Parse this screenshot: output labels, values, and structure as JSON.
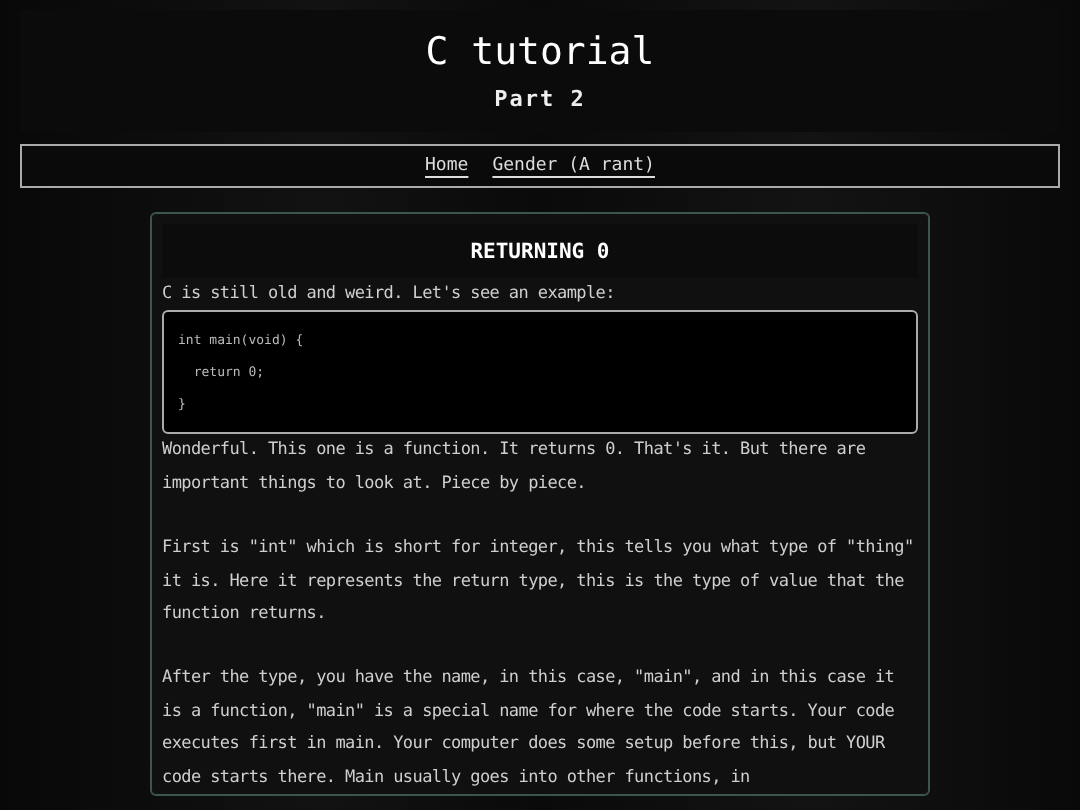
{
  "header": {
    "title": "C tutorial",
    "subtitle": "Part 2"
  },
  "nav": [
    {
      "label": "Home"
    },
    {
      "label": "Gender (A rant)"
    }
  ],
  "article": {
    "heading": "RETURNING 0",
    "intro": "C is still old and weird. Let's see an example:",
    "code_lines": [
      "int main(void) {",
      "  return 0;",
      "}"
    ],
    "paragraphs": [
      "Wonderful. This one is a function. It returns 0. That's it. But there are important things to look at. Piece by piece.",
      "First is \"int\" which is short for integer, this tells you what type of \"thing\" it is. Here it represents the return type, this is the type of value that the function returns.",
      "After the type, you have the name, in this case, \"main\", and in this case it is a function, \"main\" is a special name for where the code starts. Your code executes first in main. Your computer does some setup before this, but YOUR code starts there. Main usually goes into other functions, in"
    ]
  }
}
